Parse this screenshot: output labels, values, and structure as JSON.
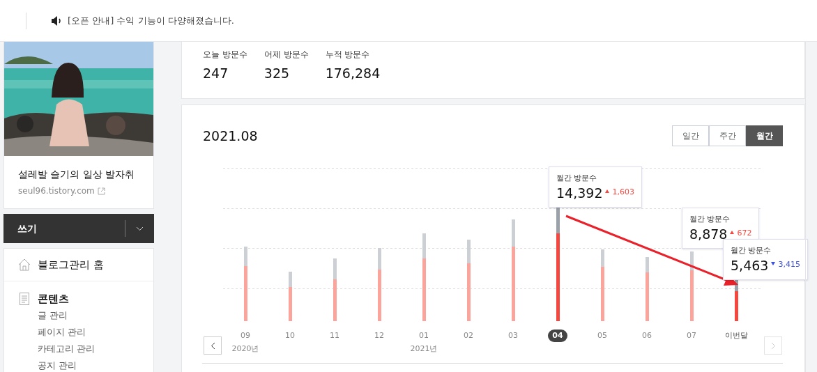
{
  "notice": {
    "text": "[오픈 안내] 수익 기능이 다양해졌습니다."
  },
  "blog": {
    "title": "설레발 슬기의 일상 발자취",
    "url": "seul96.tistory.com"
  },
  "write_button": {
    "label": "쓰기"
  },
  "sidebar": {
    "items": [
      {
        "kind": "home",
        "label": "블로그관리 홈"
      },
      {
        "kind": "section",
        "label": "콘텐츠",
        "children": [
          {
            "label": "글 관리"
          },
          {
            "label": "페이지 관리"
          },
          {
            "label": "카테고리 관리"
          },
          {
            "label": "공지 관리"
          }
        ]
      }
    ]
  },
  "stats": [
    {
      "label": "오늘 방문수",
      "value": "247"
    },
    {
      "label": "어제 방문수",
      "value": "325"
    },
    {
      "label": "누적 방문수",
      "value": "176,284"
    }
  ],
  "chart_panel": {
    "period": "2021.08",
    "tabs": [
      {
        "label": "일간",
        "selected": false
      },
      {
        "label": "주간",
        "selected": false
      },
      {
        "label": "월간",
        "selected": true
      }
    ],
    "months": [
      {
        "label": "09",
        "year": "2020년",
        "selected": false,
        "current": false
      },
      {
        "label": "10",
        "selected": false,
        "current": false
      },
      {
        "label": "11",
        "selected": false,
        "current": false
      },
      {
        "label": "12",
        "selected": false,
        "current": false
      },
      {
        "label": "01",
        "year": "2021년",
        "selected": false,
        "current": false
      },
      {
        "label": "02",
        "selected": false,
        "current": false
      },
      {
        "label": "03",
        "selected": false,
        "current": false
      },
      {
        "label": "04",
        "selected": true,
        "current": false
      },
      {
        "label": "05",
        "selected": false,
        "current": false
      },
      {
        "label": "06",
        "selected": false,
        "current": false
      },
      {
        "label": "07",
        "selected": false,
        "current": false
      },
      {
        "label": "이번달",
        "selected": false,
        "current": true
      }
    ],
    "tooltips": [
      {
        "title": "월간 방문수",
        "value": "14,392",
        "kind": "up",
        "change": "1,603"
      },
      {
        "title": "월간 방문수",
        "value": "8,878",
        "kind": "up",
        "change": "672"
      },
      {
        "title": "월간 방문수",
        "value": "5,463",
        "kind": "down",
        "change": "3,415"
      }
    ]
  }
}
